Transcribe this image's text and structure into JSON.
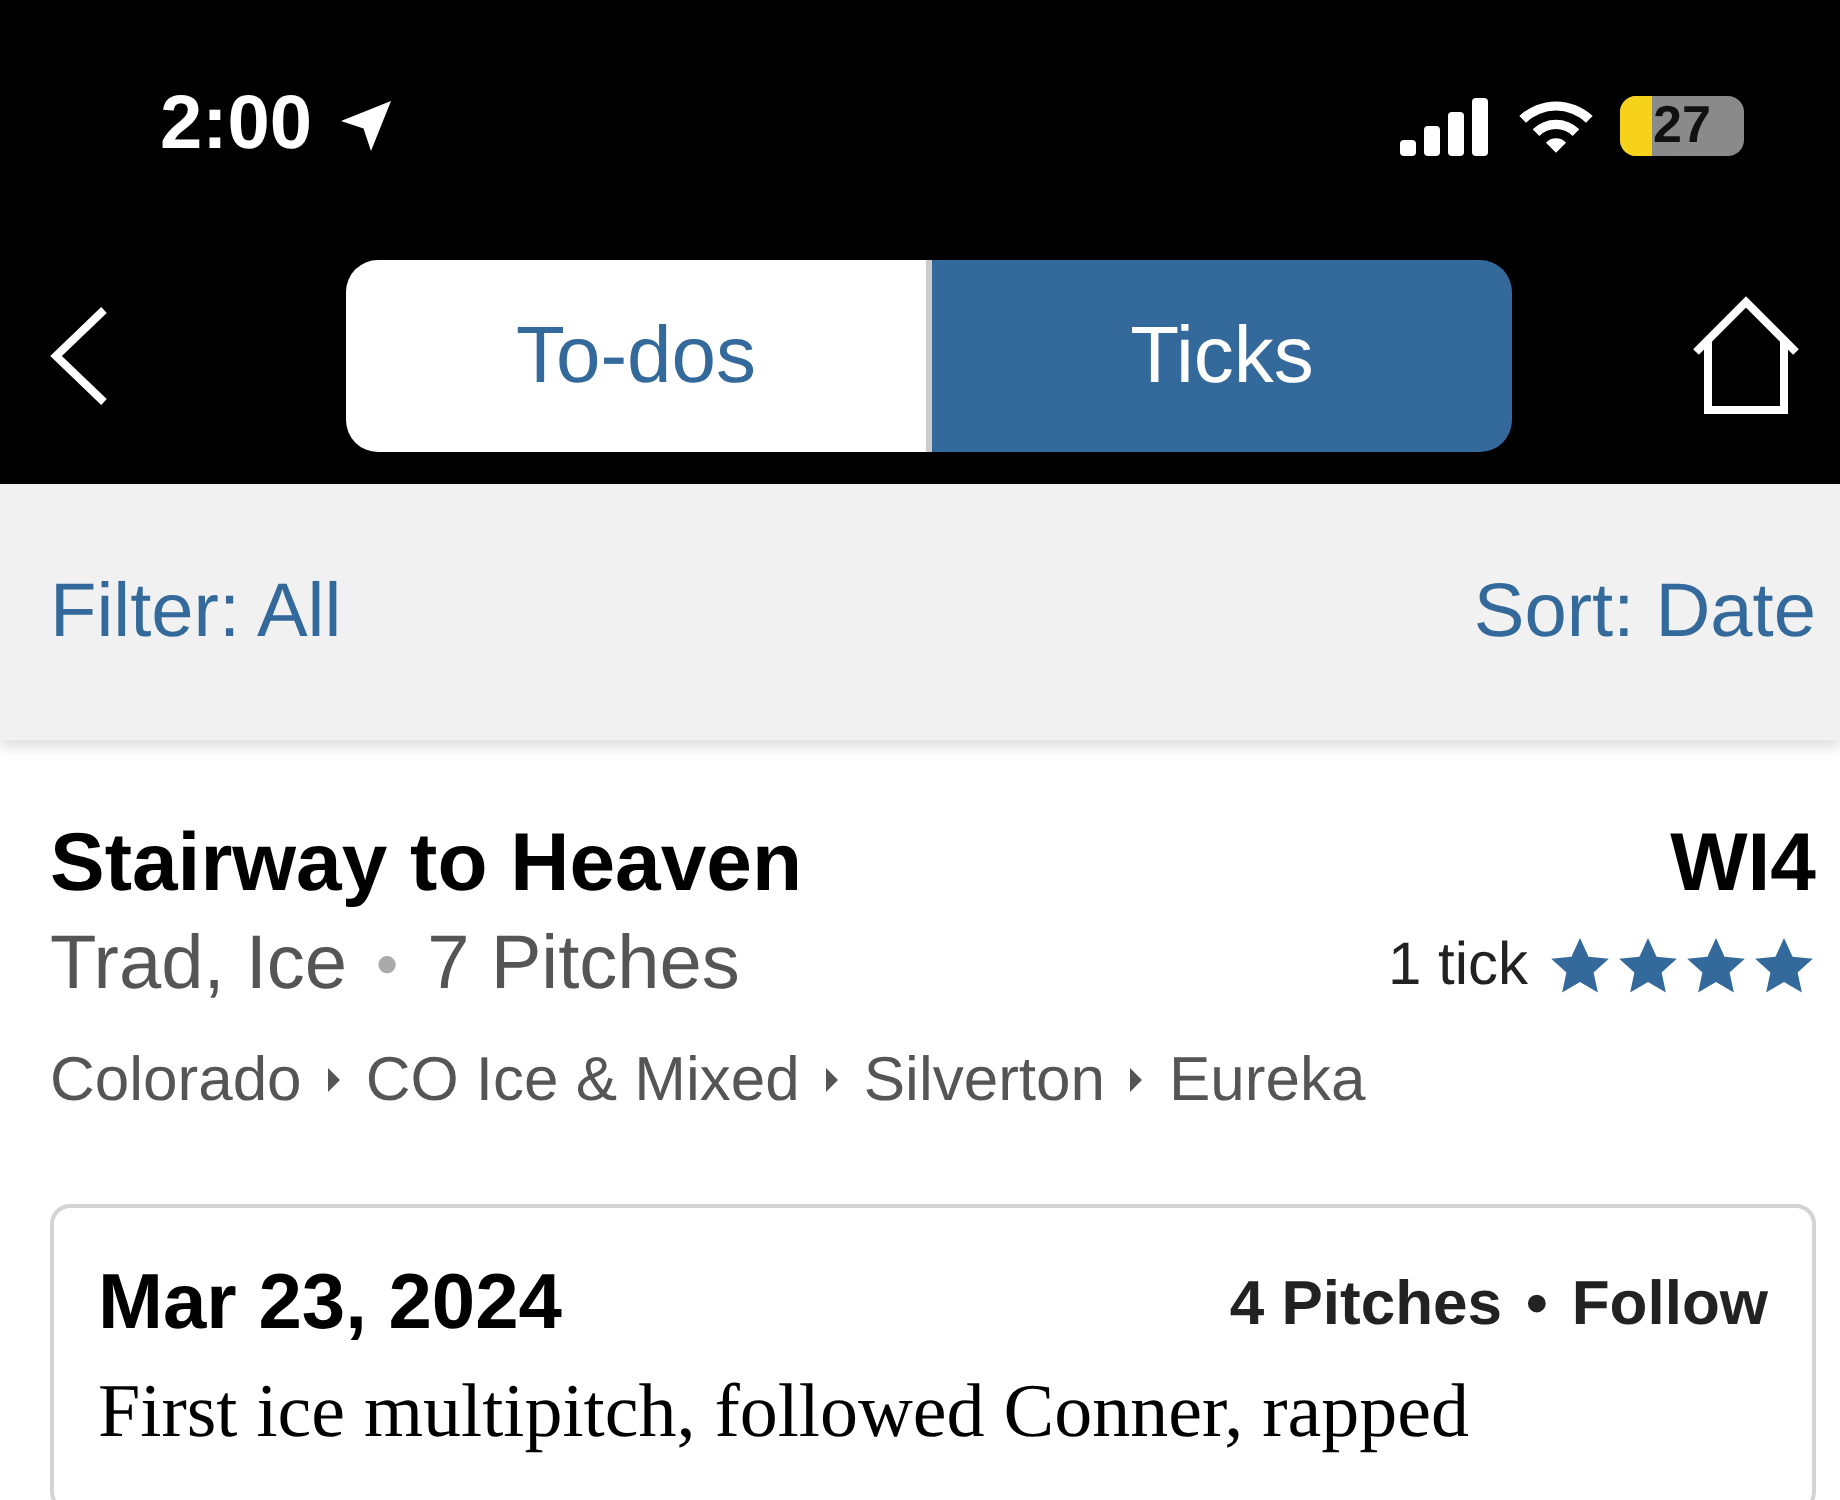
{
  "status_bar": {
    "time": "2:00",
    "battery": "27"
  },
  "tabs": [
    {
      "label": "To-dos",
      "selected": false
    },
    {
      "label": "Ticks",
      "selected": true
    }
  ],
  "filter_bar": {
    "filter": "Filter: All",
    "sort": "Sort: Date"
  },
  "route": {
    "name": "Stairway to Heaven",
    "grade": "WI4",
    "type": "Trad, Ice",
    "separator": "●",
    "pitches": "7 Pitches",
    "ticks": "1 tick",
    "stars": 4,
    "breadcrumbs": [
      "Colorado",
      "CO Ice & Mixed",
      "Silverton",
      "Eureka"
    ]
  },
  "tick_card": {
    "date": "Mar 23, 2024",
    "pitches": "4 Pitches",
    "separator": "•",
    "style": "Follow",
    "note": "First ice multipitch, followed Conner, rapped"
  }
}
